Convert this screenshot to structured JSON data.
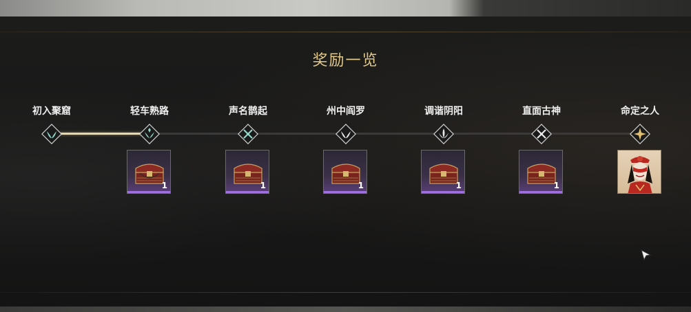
{
  "title": "奖励一览",
  "progress": {
    "completed_stages": 2,
    "total_stages": 7
  },
  "stages": [
    {
      "label": "初入聚窟",
      "icon": "leaf-emblem-icon",
      "status": "completed",
      "reward": null
    },
    {
      "label": "轻车熟路",
      "icon": "check-emblem-icon",
      "status": "completed",
      "reward": {
        "type": "treasure-chest",
        "count": "1"
      }
    },
    {
      "label": "声名鹊起",
      "icon": "crossed-swords-icon",
      "status": "locked",
      "reward": {
        "type": "treasure-chest",
        "count": "1"
      }
    },
    {
      "label": "州中阎罗",
      "icon": "wing-emblem-icon",
      "status": "locked",
      "reward": {
        "type": "treasure-chest",
        "count": "1"
      }
    },
    {
      "label": "调谐阴阳",
      "icon": "flame-emblem-icon",
      "status": "locked",
      "reward": {
        "type": "treasure-chest",
        "count": "1"
      }
    },
    {
      "label": "直面古神",
      "icon": "crossed-blades-icon",
      "status": "locked",
      "reward": {
        "type": "treasure-chest",
        "count": "1"
      }
    },
    {
      "label": "命定之人",
      "icon": "gold-star-emblem-icon",
      "status": "locked",
      "reward": {
        "type": "character-portrait",
        "count": ""
      }
    }
  ],
  "colors": {
    "title": "#e3c98a",
    "track_filled": "#e8d9a8",
    "track_empty": "#3a3a3a",
    "emblem_teal": "#8fd6c6",
    "emblem_white": "#e8e8e8",
    "emblem_gold": "#e0c070",
    "reward_rarity": "#a070e0"
  }
}
